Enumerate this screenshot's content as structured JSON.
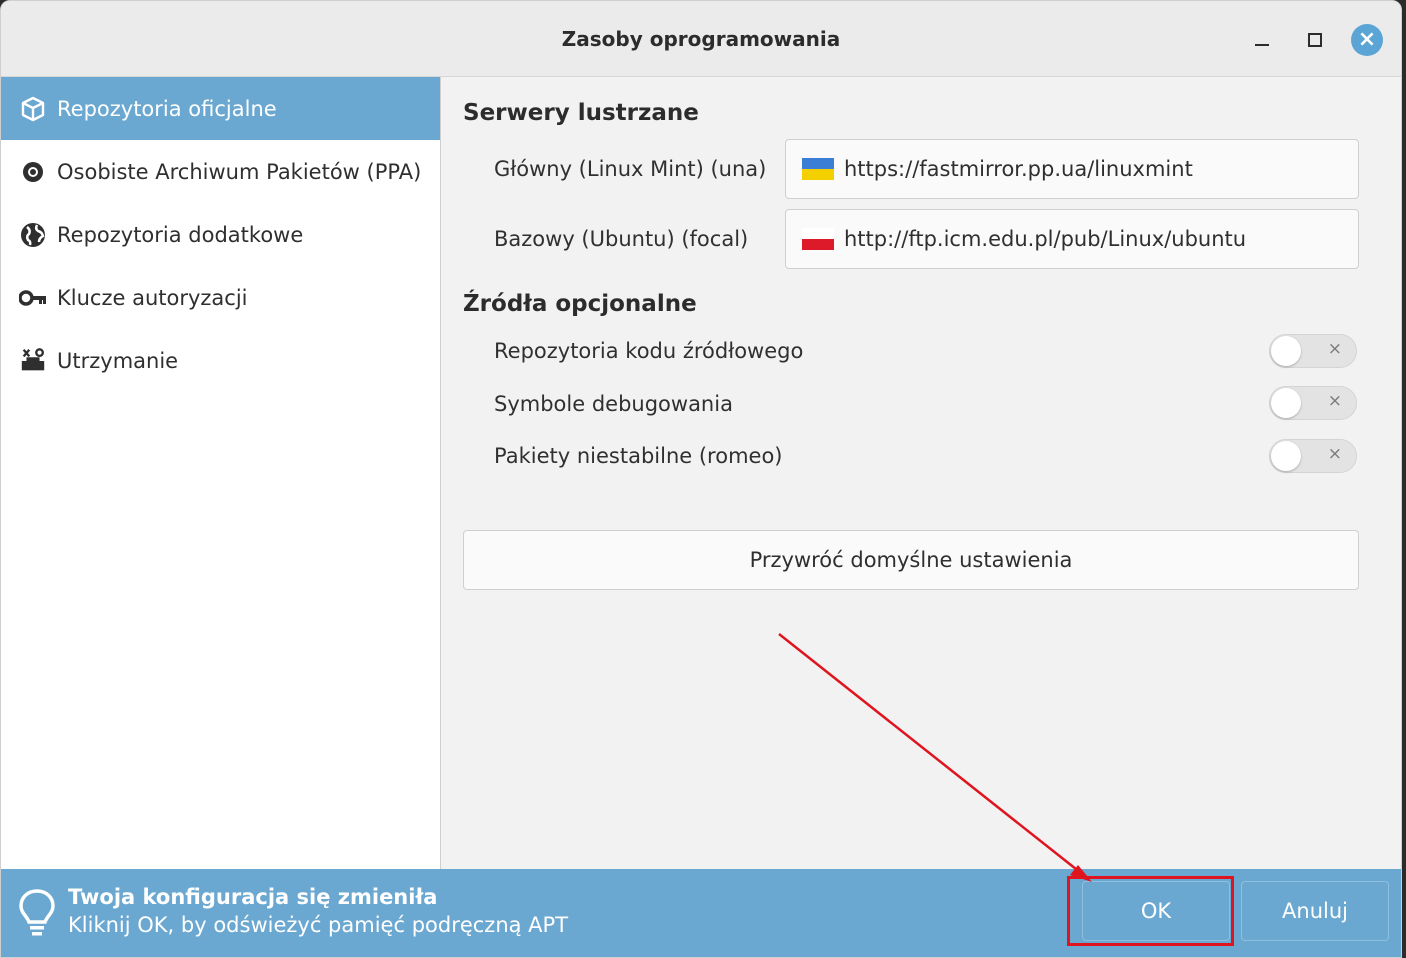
{
  "window": {
    "title": "Zasoby oprogramowania"
  },
  "sidebar": {
    "items": [
      {
        "label": "Repozytoria oficjalne",
        "icon": "package-icon",
        "active": true
      },
      {
        "label": "Osobiste Archiwum Pakietów (PPA)",
        "icon": "ppa-icon"
      },
      {
        "label": "Repozytoria dodatkowe",
        "icon": "globe-icon"
      },
      {
        "label": "Klucze autoryzacji",
        "icon": "key-icon"
      },
      {
        "label": "Utrzymanie",
        "icon": "maintenance-icon"
      }
    ]
  },
  "mirrors": {
    "title": "Serwery lustrzane",
    "main": {
      "label": "Główny (Linux Mint) (una)",
      "url": "https://fastmirror.pp.ua/linuxmint",
      "flag": "ukraine-flag"
    },
    "base": {
      "label": "Bazowy (Ubuntu) (focal)",
      "url": "http://ftp.icm.edu.pl/pub/Linux/ubuntu",
      "flag": "poland-flag"
    }
  },
  "optional": {
    "title": "Źródła opcjonalne",
    "items": [
      {
        "label": "Repozytoria kodu źródłowego",
        "enabled": false
      },
      {
        "label": "Symbole debugowania",
        "enabled": false
      },
      {
        "label": "Pakiety niestabilne (romeo)",
        "enabled": false
      }
    ],
    "toggle_off_symbol": "×"
  },
  "restore_label": "Przywróć domyślne ustawienia",
  "infobar": {
    "title": "Twoja konfiguracja się zmieniła",
    "text": "Kliknij OK, by odświeżyć pamięć podręczną APT",
    "ok_label": "OK",
    "cancel_label": "Anuluj"
  },
  "colors": {
    "accent": "#6ba8d1",
    "annotation": "#e0141e"
  }
}
